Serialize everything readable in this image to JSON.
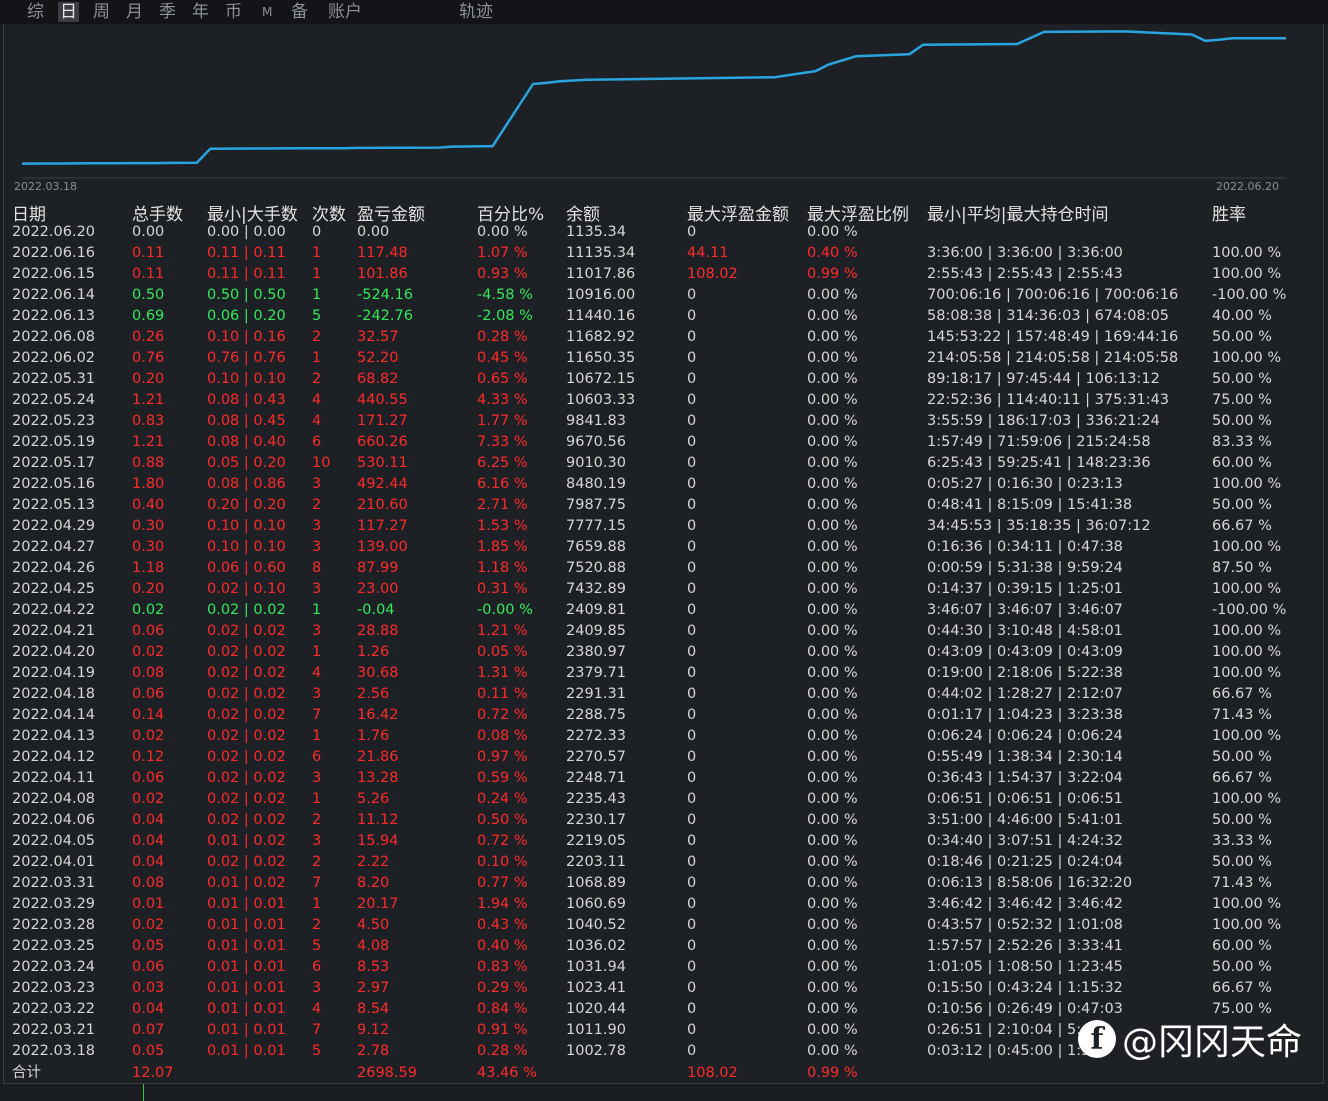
{
  "tabs": [
    {
      "label": "综",
      "active": false
    },
    {
      "label": "日",
      "active": true
    },
    {
      "label": "周",
      "active": false
    },
    {
      "label": "月",
      "active": false
    },
    {
      "label": "季",
      "active": false
    },
    {
      "label": "年",
      "active": false
    },
    {
      "label": "币",
      "active": false
    },
    {
      "label": "M",
      "active": false
    },
    {
      "label": "备",
      "active": false
    },
    {
      "label": "账户",
      "active": false
    },
    {
      "label": "轨迹",
      "active": false
    }
  ],
  "chart": {
    "start_date": "2022.03.18",
    "end_date": "2022.06.20",
    "line_color": "#2aa4e0"
  },
  "chart_data": {
    "type": "line",
    "x": [
      "2022.03.18",
      "2022.03.21",
      "2022.03.22",
      "2022.03.23",
      "2022.03.24",
      "2022.03.25",
      "2022.03.28",
      "2022.03.29",
      "2022.03.31",
      "2022.04.01",
      "2022.04.05",
      "2022.04.06",
      "2022.04.08",
      "2022.04.11",
      "2022.04.12",
      "2022.04.13",
      "2022.04.14",
      "2022.04.18",
      "2022.04.19",
      "2022.04.20",
      "2022.04.21",
      "2022.04.22",
      "2022.04.25",
      "2022.04.26",
      "2022.04.27",
      "2022.04.29",
      "2022.05.13",
      "2022.05.16",
      "2022.05.17",
      "2022.05.19",
      "2022.05.23",
      "2022.05.24",
      "2022.05.31",
      "2022.06.02",
      "2022.06.08",
      "2022.06.13",
      "2022.06.14",
      "2022.06.15",
      "2022.06.16",
      "2022.06.20"
    ],
    "series": [
      {
        "values": [
          1002.78,
          1011.9,
          1020.44,
          1023.41,
          1031.94,
          1036.02,
          1040.52,
          1060.69,
          1068.89,
          2203.11,
          2219.05,
          2230.17,
          2235.43,
          2248.71,
          2270.57,
          2272.33,
          2288.75,
          2291.31,
          2379.71,
          2380.97,
          2409.85,
          2409.81,
          7432.89,
          7520.88,
          7659.88,
          7777.15,
          7987.75,
          8480.19,
          9010.3,
          9670.56,
          9841.83,
          10603.33,
          10672.15,
          11650.35,
          11682.92,
          11440.16,
          10916.0,
          11017.86,
          11135.34,
          11135.34
        ]
      }
    ]
  },
  "columns": {
    "date": "日期",
    "lots": "总手数",
    "minmax": "最小|大手数",
    "count": "次数",
    "pnl": "盈亏金额",
    "pct": "百分比%",
    "balance": "余额",
    "max_float_amt": "最大浮盈金额",
    "max_float_ratio": "最大浮盈比例",
    "hold_time": "最小|平均|最大持仓时间",
    "winrate": "胜率"
  },
  "colors": {
    "profit": "#ff2a2a",
    "loss": "#33e85a",
    "neutral": "#d6d6d6"
  },
  "rows": [
    {
      "date": "2022.06.20",
      "lots": "0.00",
      "minmax": "0.00 | 0.00",
      "count": "0",
      "pnl": "0.00",
      "pct": "0.00 %",
      "balance": "1135.34",
      "mfa": "0",
      "mfr": "0.00 %",
      "time": "",
      "win": "",
      "cls": "n",
      "mfacls": "n",
      "mfrcls": "n"
    },
    {
      "date": "2022.06.16",
      "lots": "0.11",
      "minmax": "0.11 | 0.11",
      "count": "1",
      "pnl": "117.48",
      "pct": "1.07 %",
      "balance": "11135.34",
      "mfa": "44.11",
      "mfr": "0.40 %",
      "time": "3:36:00 | 3:36:00 | 3:36:00",
      "win": "100.00 %",
      "cls": "r",
      "mfacls": "r",
      "mfrcls": "r"
    },
    {
      "date": "2022.06.15",
      "lots": "0.11",
      "minmax": "0.11 | 0.11",
      "count": "1",
      "pnl": "101.86",
      "pct": "0.93 %",
      "balance": "11017.86",
      "mfa": "108.02",
      "mfr": "0.99 %",
      "time": "2:55:43 | 2:55:43 | 2:55:43",
      "win": "100.00 %",
      "cls": "r",
      "mfacls": "r",
      "mfrcls": "r"
    },
    {
      "date": "2022.06.14",
      "lots": "0.50",
      "minmax": "0.50 | 0.50",
      "count": "1",
      "pnl": "-524.16",
      "pct": "-4.58 %",
      "balance": "10916.00",
      "mfa": "0",
      "mfr": "0.00 %",
      "time": "700:06:16 | 700:06:16 | 700:06:16",
      "win": "-100.00 %",
      "cls": "g",
      "mfacls": "n",
      "mfrcls": "n"
    },
    {
      "date": "2022.06.13",
      "lots": "0.69",
      "minmax": "0.06 | 0.20",
      "count": "5",
      "pnl": "-242.76",
      "pct": "-2.08 %",
      "balance": "11440.16",
      "mfa": "0",
      "mfr": "0.00 %",
      "time": "58:08:38 | 314:36:03 | 674:08:05",
      "win": "40.00 %",
      "cls": "g",
      "mfacls": "n",
      "mfrcls": "n"
    },
    {
      "date": "2022.06.08",
      "lots": "0.26",
      "minmax": "0.10 | 0.16",
      "count": "2",
      "pnl": "32.57",
      "pct": "0.28 %",
      "balance": "11682.92",
      "mfa": "0",
      "mfr": "0.00 %",
      "time": "145:53:22 | 157:48:49 | 169:44:16",
      "win": "50.00 %",
      "cls": "r",
      "mfacls": "n",
      "mfrcls": "n"
    },
    {
      "date": "2022.06.02",
      "lots": "0.76",
      "minmax": "0.76 | 0.76",
      "count": "1",
      "pnl": "52.20",
      "pct": "0.45 %",
      "balance": "11650.35",
      "mfa": "0",
      "mfr": "0.00 %",
      "time": "214:05:58 | 214:05:58 | 214:05:58",
      "win": "100.00 %",
      "cls": "r",
      "mfacls": "n",
      "mfrcls": "n"
    },
    {
      "date": "2022.05.31",
      "lots": "0.20",
      "minmax": "0.10 | 0.10",
      "count": "2",
      "pnl": "68.82",
      "pct": "0.65 %",
      "balance": "10672.15",
      "mfa": "0",
      "mfr": "0.00 %",
      "time": "89:18:17 | 97:45:44 | 106:13:12",
      "win": "50.00 %",
      "cls": "r",
      "mfacls": "n",
      "mfrcls": "n"
    },
    {
      "date": "2022.05.24",
      "lots": "1.21",
      "minmax": "0.08 | 0.43",
      "count": "4",
      "pnl": "440.55",
      "pct": "4.33 %",
      "balance": "10603.33",
      "mfa": "0",
      "mfr": "0.00 %",
      "time": "22:52:36 | 114:40:11 | 375:31:43",
      "win": "75.00 %",
      "cls": "r",
      "mfacls": "n",
      "mfrcls": "n"
    },
    {
      "date": "2022.05.23",
      "lots": "0.83",
      "minmax": "0.08 | 0.45",
      "count": "4",
      "pnl": "171.27",
      "pct": "1.77 %",
      "balance": "9841.83",
      "mfa": "0",
      "mfr": "0.00 %",
      "time": "3:55:59 | 186:17:03 | 336:21:24",
      "win": "50.00 %",
      "cls": "r",
      "mfacls": "n",
      "mfrcls": "n"
    },
    {
      "date": "2022.05.19",
      "lots": "1.21",
      "minmax": "0.08 | 0.40",
      "count": "6",
      "pnl": "660.26",
      "pct": "7.33 %",
      "balance": "9670.56",
      "mfa": "0",
      "mfr": "0.00 %",
      "time": "1:57:49 | 71:59:06 | 215:24:58",
      "win": "83.33 %",
      "cls": "r",
      "mfacls": "n",
      "mfrcls": "n"
    },
    {
      "date": "2022.05.17",
      "lots": "0.88",
      "minmax": "0.05 | 0.20",
      "count": "10",
      "pnl": "530.11",
      "pct": "6.25 %",
      "balance": "9010.30",
      "mfa": "0",
      "mfr": "0.00 %",
      "time": "6:25:43 | 59:25:41 | 148:23:36",
      "win": "60.00 %",
      "cls": "r",
      "mfacls": "n",
      "mfrcls": "n"
    },
    {
      "date": "2022.05.16",
      "lots": "1.80",
      "minmax": "0.08 | 0.86",
      "count": "3",
      "pnl": "492.44",
      "pct": "6.16 %",
      "balance": "8480.19",
      "mfa": "0",
      "mfr": "0.00 %",
      "time": "0:05:27 | 0:16:30 | 0:23:13",
      "win": "100.00 %",
      "cls": "r",
      "mfacls": "n",
      "mfrcls": "n"
    },
    {
      "date": "2022.05.13",
      "lots": "0.40",
      "minmax": "0.20 | 0.20",
      "count": "2",
      "pnl": "210.60",
      "pct": "2.71 %",
      "balance": "7987.75",
      "mfa": "0",
      "mfr": "0.00 %",
      "time": "0:48:41 | 8:15:09 | 15:41:38",
      "win": "50.00 %",
      "cls": "r",
      "mfacls": "n",
      "mfrcls": "n"
    },
    {
      "date": "2022.04.29",
      "lots": "0.30",
      "minmax": "0.10 | 0.10",
      "count": "3",
      "pnl": "117.27",
      "pct": "1.53 %",
      "balance": "7777.15",
      "mfa": "0",
      "mfr": "0.00 %",
      "time": "34:45:53 | 35:18:35 | 36:07:12",
      "win": "66.67 %",
      "cls": "r",
      "mfacls": "n",
      "mfrcls": "n"
    },
    {
      "date": "2022.04.27",
      "lots": "0.30",
      "minmax": "0.10 | 0.10",
      "count": "3",
      "pnl": "139.00",
      "pct": "1.85 %",
      "balance": "7659.88",
      "mfa": "0",
      "mfr": "0.00 %",
      "time": "0:16:36 | 0:34:11 | 0:47:38",
      "win": "100.00 %",
      "cls": "r",
      "mfacls": "n",
      "mfrcls": "n"
    },
    {
      "date": "2022.04.26",
      "lots": "1.18",
      "minmax": "0.06 | 0.60",
      "count": "8",
      "pnl": "87.99",
      "pct": "1.18 %",
      "balance": "7520.88",
      "mfa": "0",
      "mfr": "0.00 %",
      "time": "0:00:59 | 5:31:38 | 9:59:24",
      "win": "87.50 %",
      "cls": "r",
      "mfacls": "n",
      "mfrcls": "n"
    },
    {
      "date": "2022.04.25",
      "lots": "0.20",
      "minmax": "0.02 | 0.10",
      "count": "3",
      "pnl": "23.00",
      "pct": "0.31 %",
      "balance": "7432.89",
      "mfa": "0",
      "mfr": "0.00 %",
      "time": "0:14:37 | 0:39:15 | 1:25:01",
      "win": "100.00 %",
      "cls": "r",
      "mfacls": "n",
      "mfrcls": "n"
    },
    {
      "date": "2022.04.22",
      "lots": "0.02",
      "minmax": "0.02 | 0.02",
      "count": "1",
      "pnl": "-0.04",
      "pct": "-0.00 %",
      "balance": "2409.81",
      "mfa": "0",
      "mfr": "0.00 %",
      "time": "3:46:07 | 3:46:07 | 3:46:07",
      "win": "-100.00 %",
      "cls": "g",
      "mfacls": "n",
      "mfrcls": "n"
    },
    {
      "date": "2022.04.21",
      "lots": "0.06",
      "minmax": "0.02 | 0.02",
      "count": "3",
      "pnl": "28.88",
      "pct": "1.21 %",
      "balance": "2409.85",
      "mfa": "0",
      "mfr": "0.00 %",
      "time": "0:44:30 | 3:10:48 | 4:58:01",
      "win": "100.00 %",
      "cls": "r",
      "mfacls": "n",
      "mfrcls": "n"
    },
    {
      "date": "2022.04.20",
      "lots": "0.02",
      "minmax": "0.02 | 0.02",
      "count": "1",
      "pnl": "1.26",
      "pct": "0.05 %",
      "balance": "2380.97",
      "mfa": "0",
      "mfr": "0.00 %",
      "time": "0:43:09 | 0:43:09 | 0:43:09",
      "win": "100.00 %",
      "cls": "r",
      "mfacls": "n",
      "mfrcls": "n"
    },
    {
      "date": "2022.04.19",
      "lots": "0.08",
      "minmax": "0.02 | 0.02",
      "count": "4",
      "pnl": "30.68",
      "pct": "1.31 %",
      "balance": "2379.71",
      "mfa": "0",
      "mfr": "0.00 %",
      "time": "0:19:00 | 2:18:06 | 5:22:38",
      "win": "100.00 %",
      "cls": "r",
      "mfacls": "n",
      "mfrcls": "n"
    },
    {
      "date": "2022.04.18",
      "lots": "0.06",
      "minmax": "0.02 | 0.02",
      "count": "3",
      "pnl": "2.56",
      "pct": "0.11 %",
      "balance": "2291.31",
      "mfa": "0",
      "mfr": "0.00 %",
      "time": "0:44:02 | 1:28:27 | 2:12:07",
      "win": "66.67 %",
      "cls": "r",
      "mfacls": "n",
      "mfrcls": "n"
    },
    {
      "date": "2022.04.14",
      "lots": "0.14",
      "minmax": "0.02 | 0.02",
      "count": "7",
      "pnl": "16.42",
      "pct": "0.72 %",
      "balance": "2288.75",
      "mfa": "0",
      "mfr": "0.00 %",
      "time": "0:01:17 | 1:04:23 | 3:23:38",
      "win": "71.43 %",
      "cls": "r",
      "mfacls": "n",
      "mfrcls": "n"
    },
    {
      "date": "2022.04.13",
      "lots": "0.02",
      "minmax": "0.02 | 0.02",
      "count": "1",
      "pnl": "1.76",
      "pct": "0.08 %",
      "balance": "2272.33",
      "mfa": "0",
      "mfr": "0.00 %",
      "time": "0:06:24 | 0:06:24 | 0:06:24",
      "win": "100.00 %",
      "cls": "r",
      "mfacls": "n",
      "mfrcls": "n"
    },
    {
      "date": "2022.04.12",
      "lots": "0.12",
      "minmax": "0.02 | 0.02",
      "count": "6",
      "pnl": "21.86",
      "pct": "0.97 %",
      "balance": "2270.57",
      "mfa": "0",
      "mfr": "0.00 %",
      "time": "0:55:49 | 1:38:34 | 2:30:14",
      "win": "50.00 %",
      "cls": "r",
      "mfacls": "n",
      "mfrcls": "n"
    },
    {
      "date": "2022.04.11",
      "lots": "0.06",
      "minmax": "0.02 | 0.02",
      "count": "3",
      "pnl": "13.28",
      "pct": "0.59 %",
      "balance": "2248.71",
      "mfa": "0",
      "mfr": "0.00 %",
      "time": "0:36:43 | 1:54:37 | 3:22:04",
      "win": "66.67 %",
      "cls": "r",
      "mfacls": "n",
      "mfrcls": "n"
    },
    {
      "date": "2022.04.08",
      "lots": "0.02",
      "minmax": "0.02 | 0.02",
      "count": "1",
      "pnl": "5.26",
      "pct": "0.24 %",
      "balance": "2235.43",
      "mfa": "0",
      "mfr": "0.00 %",
      "time": "0:06:51 | 0:06:51 | 0:06:51",
      "win": "100.00 %",
      "cls": "r",
      "mfacls": "n",
      "mfrcls": "n"
    },
    {
      "date": "2022.04.06",
      "lots": "0.04",
      "minmax": "0.02 | 0.02",
      "count": "2",
      "pnl": "11.12",
      "pct": "0.50 %",
      "balance": "2230.17",
      "mfa": "0",
      "mfr": "0.00 %",
      "time": "3:51:00 | 4:46:00 | 5:41:01",
      "win": "50.00 %",
      "cls": "r",
      "mfacls": "n",
      "mfrcls": "n"
    },
    {
      "date": "2022.04.05",
      "lots": "0.04",
      "minmax": "0.01 | 0.02",
      "count": "3",
      "pnl": "15.94",
      "pct": "0.72 %",
      "balance": "2219.05",
      "mfa": "0",
      "mfr": "0.00 %",
      "time": "0:34:40 | 3:07:51 | 4:24:32",
      "win": "33.33 %",
      "cls": "r",
      "mfacls": "n",
      "mfrcls": "n"
    },
    {
      "date": "2022.04.01",
      "lots": "0.04",
      "minmax": "0.02 | 0.02",
      "count": "2",
      "pnl": "2.22",
      "pct": "0.10 %",
      "balance": "2203.11",
      "mfa": "0",
      "mfr": "0.00 %",
      "time": "0:18:46 | 0:21:25 | 0:24:04",
      "win": "50.00 %",
      "cls": "r",
      "mfacls": "n",
      "mfrcls": "n"
    },
    {
      "date": "2022.03.31",
      "lots": "0.08",
      "minmax": "0.01 | 0.02",
      "count": "7",
      "pnl": "8.20",
      "pct": "0.77 %",
      "balance": "1068.89",
      "mfa": "0",
      "mfr": "0.00 %",
      "time": "0:06:13 | 8:58:06 | 16:32:20",
      "win": "71.43 %",
      "cls": "r",
      "mfacls": "n",
      "mfrcls": "n"
    },
    {
      "date": "2022.03.29",
      "lots": "0.01",
      "minmax": "0.01 | 0.01",
      "count": "1",
      "pnl": "20.17",
      "pct": "1.94 %",
      "balance": "1060.69",
      "mfa": "0",
      "mfr": "0.00 %",
      "time": "3:46:42 | 3:46:42 | 3:46:42",
      "win": "100.00 %",
      "cls": "r",
      "mfacls": "n",
      "mfrcls": "n"
    },
    {
      "date": "2022.03.28",
      "lots": "0.02",
      "minmax": "0.01 | 0.01",
      "count": "2",
      "pnl": "4.50",
      "pct": "0.43 %",
      "balance": "1040.52",
      "mfa": "0",
      "mfr": "0.00 %",
      "time": "0:43:57 | 0:52:32 | 1:01:08",
      "win": "100.00 %",
      "cls": "r",
      "mfacls": "n",
      "mfrcls": "n"
    },
    {
      "date": "2022.03.25",
      "lots": "0.05",
      "minmax": "0.01 | 0.01",
      "count": "5",
      "pnl": "4.08",
      "pct": "0.40 %",
      "balance": "1036.02",
      "mfa": "0",
      "mfr": "0.00 %",
      "time": "1:57:57 | 2:52:26 | 3:33:41",
      "win": "60.00 %",
      "cls": "r",
      "mfacls": "n",
      "mfrcls": "n"
    },
    {
      "date": "2022.03.24",
      "lots": "0.06",
      "minmax": "0.01 | 0.01",
      "count": "6",
      "pnl": "8.53",
      "pct": "0.83 %",
      "balance": "1031.94",
      "mfa": "0",
      "mfr": "0.00 %",
      "time": "1:01:05 | 1:08:50 | 1:23:45",
      "win": "50.00 %",
      "cls": "r",
      "mfacls": "n",
      "mfrcls": "n"
    },
    {
      "date": "2022.03.23",
      "lots": "0.03",
      "minmax": "0.01 | 0.01",
      "count": "3",
      "pnl": "2.97",
      "pct": "0.29 %",
      "balance": "1023.41",
      "mfa": "0",
      "mfr": "0.00 %",
      "time": "0:15:50 | 0:43:24 | 1:15:32",
      "win": "66.67 %",
      "cls": "r",
      "mfacls": "n",
      "mfrcls": "n"
    },
    {
      "date": "2022.03.22",
      "lots": "0.04",
      "minmax": "0.01 | 0.01",
      "count": "4",
      "pnl": "8.54",
      "pct": "0.84 %",
      "balance": "1020.44",
      "mfa": "0",
      "mfr": "0.00 %",
      "time": "0:10:56 | 0:26:49 | 0:47:03",
      "win": "75.00 %",
      "cls": "r",
      "mfacls": "n",
      "mfrcls": "n"
    },
    {
      "date": "2022.03.21",
      "lots": "0.07",
      "minmax": "0.01 | 0.01",
      "count": "7",
      "pnl": "9.12",
      "pct": "0.91 %",
      "balance": "1011.90",
      "mfa": "0",
      "mfr": "0.00 %",
      "time": "0:26:51 | 2:10:04 | 5:4",
      "win": "",
      "cls": "r",
      "mfacls": "n",
      "mfrcls": "n"
    },
    {
      "date": "2022.03.18",
      "lots": "0.05",
      "minmax": "0.01 | 0.01",
      "count": "5",
      "pnl": "2.78",
      "pct": "0.28 %",
      "balance": "1002.78",
      "mfa": "0",
      "mfr": "0.00 %",
      "time": "0:03:12 | 0:45:00 | 1:3",
      "win": "",
      "cls": "r",
      "mfacls": "n",
      "mfrcls": "n"
    }
  ],
  "total": {
    "label": "合计",
    "lots": "12.07",
    "pnl": "2698.59",
    "pct": "43.46 %",
    "mfa": "108.02",
    "mfr": "0.99 %"
  },
  "watermark": {
    "icon": "weibo-style-logo-icon",
    "glyph": "f",
    "text": "@冈冈天命"
  }
}
